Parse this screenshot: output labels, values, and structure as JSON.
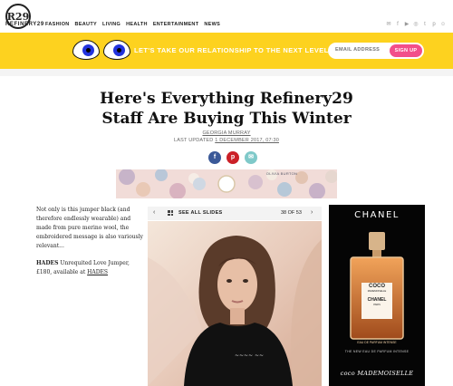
{
  "brand": {
    "name": "REFINERY29",
    "mark": "R29"
  },
  "nav": {
    "items": [
      "FASHION",
      "BEAUTY",
      "LIVING",
      "HEALTH",
      "ENTERTAINMENT",
      "NEWS"
    ],
    "social_icons": [
      "mail-icon",
      "facebook-icon",
      "youtube-icon",
      "instagram-icon",
      "twitter-icon",
      "pinterest-icon",
      "snapchat-icon"
    ]
  },
  "banner": {
    "text": "LET'S TAKE OUR RELATIONSHIP TO THE NEXT LEVEL",
    "email_placeholder": "EMAIL ADDRESS",
    "signup_label": "SIGN UP",
    "bg_color": "#fdd21f",
    "button_color": "#f24f8a"
  },
  "article": {
    "title_line1": "Here's Everything Refinery29",
    "title_line2": "Staff Are Buying This Winter",
    "author": "GEORGIA MURRAY",
    "updated_prefix": "LAST UPDATED",
    "updated_date": "1 DECEMBER 2017, 07:30",
    "share": {
      "facebook": "f",
      "pinterest": "p",
      "email": "✉"
    },
    "body_p1": "Not only is this jumper black (and therefore endlessly wearable) and made from pure merino wool, the embroidered message is also variously relevant...",
    "body_brand": "HADES",
    "body_p2_rest": " Unrequited Love Jumper, £180, available at ",
    "body_link": "HADES"
  },
  "ad_banner": {
    "logo": "OLIVIA BURTON"
  },
  "slideshow": {
    "see_all": "SEE ALL SLIDES",
    "count": "38 OF 53",
    "current": 38,
    "total": 53
  },
  "chanel_ad": {
    "title": "CHANEL",
    "bottle_line1": "COCO",
    "bottle_line2": "MADEMOISELLE",
    "bottle_brand": "CHANEL",
    "bottle_city": "PARIS",
    "bottle_edp": "EAU DE PARFUM INTENSE",
    "subtitle": "THE NEW EAU DE PARFUM INTENSE",
    "signature": "coco MADEMOISELLE"
  }
}
